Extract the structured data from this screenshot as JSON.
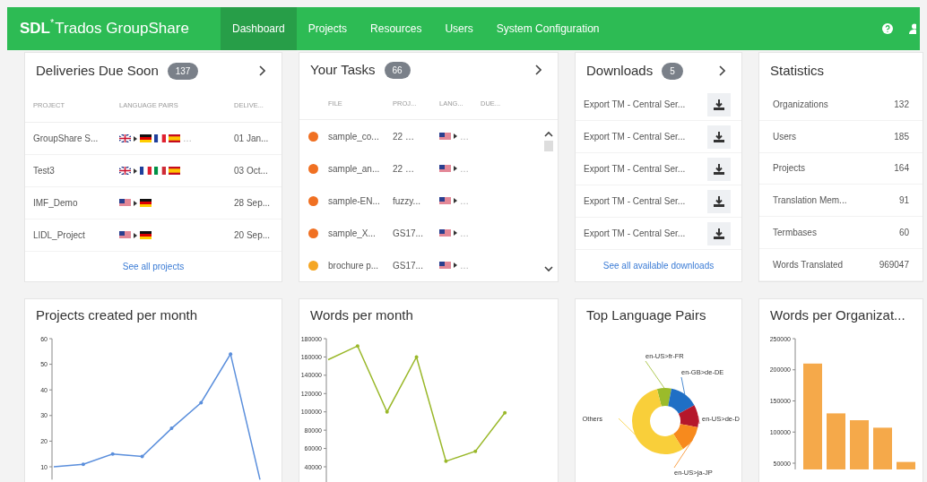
{
  "header": {
    "logo": {
      "brand": "SDL",
      "mark": "*",
      "product": "Trados GroupShare"
    },
    "nav": [
      {
        "label": "Dashboard",
        "selected": true
      },
      {
        "label": "Projects",
        "selected": false
      },
      {
        "label": "Resources",
        "selected": false
      },
      {
        "label": "Users",
        "selected": false
      },
      {
        "label": "System Configuration",
        "selected": false
      }
    ]
  },
  "deliveries": {
    "title": "Deliveries Due Soon",
    "count": "137",
    "columns": [
      "PROJECT",
      "LANGUAGE PAIRS",
      "DELIVE..."
    ],
    "rows": [
      {
        "project": "GroupShare S...",
        "source": {
          "kind": "uk"
        },
        "targets": [
          {
            "kind": "de"
          },
          {
            "kind": "fr"
          },
          {
            "kind": "es"
          }
        ],
        "more": "…",
        "date": "01 Jan..."
      },
      {
        "project": "Test3",
        "source": {
          "kind": "uk"
        },
        "targets": [
          {
            "kind": "fr"
          },
          {
            "kind": "it"
          },
          {
            "kind": "es"
          }
        ],
        "date": "03 Oct..."
      },
      {
        "project": "IMF_Demo",
        "source": {
          "kind": "us"
        },
        "targets": [
          {
            "kind": "de"
          }
        ],
        "date": "28 Sep..."
      },
      {
        "project": "LIDL_Project",
        "source": {
          "kind": "us"
        },
        "targets": [
          {
            "kind": "de"
          }
        ],
        "date": "20 Sep..."
      }
    ],
    "link": "See all projects"
  },
  "tasks": {
    "title": "Your Tasks",
    "count": "66",
    "columns": [
      "FILE",
      "PROJ...",
      "LANG...",
      "DUE..."
    ],
    "rows": [
      {
        "color": "#f07022",
        "file": "sample_co...",
        "project": "22 …",
        "source": {
          "kind": "us"
        },
        "more": "…"
      },
      {
        "color": "#f07022",
        "file": "sample_an...",
        "project": "22 …",
        "source": {
          "kind": "us"
        },
        "more": "…"
      },
      {
        "color": "#f07022",
        "file": "sample-EN...",
        "project": "fuzzy...",
        "source": {
          "kind": "us"
        },
        "more": "…"
      },
      {
        "color": "#f07022",
        "file": "sample_X...",
        "project": "GS17...",
        "source": {
          "kind": "us"
        },
        "more": "…"
      },
      {
        "color": "#f5a623",
        "file": "brochure p...",
        "project": "GS17...",
        "source": {
          "kind": "us"
        },
        "more": "…"
      }
    ]
  },
  "downloads": {
    "title": "Downloads",
    "count": "5",
    "items": [
      "Export TM - Central Ser...",
      "Export TM - Central Ser...",
      "Export TM - Central Ser...",
      "Export TM - Central Ser...",
      "Export TM - Central Ser..."
    ],
    "link": "See all available downloads"
  },
  "statistics": {
    "title": "Statistics",
    "rows": [
      {
        "label": "Organizations",
        "value": "132"
      },
      {
        "label": "Users",
        "value": "185"
      },
      {
        "label": "Projects",
        "value": "164"
      },
      {
        "label": "Translation Mem...",
        "value": "91"
      },
      {
        "label": "Termbases",
        "value": "60"
      },
      {
        "label": "Words Translated",
        "value": "969047"
      }
    ]
  },
  "charts": [
    {
      "title": "Projects created per month",
      "chart_data": {
        "type": "line",
        "series": [
          {
            "color": "#5b8fdc",
            "values": [
              10,
              11,
              15,
              14,
              25,
              35,
              54,
              5
            ]
          }
        ],
        "yticks": [
          10,
          20,
          30,
          40,
          50,
          60
        ],
        "ylim": [
          5,
          60
        ]
      }
    },
    {
      "title": "Words per month",
      "chart_data": {
        "type": "line",
        "series": [
          {
            "color": "#9ab82a",
            "values": [
              157000,
              172000,
              100000,
              160000,
              46000,
              57000,
              99000,
              null
            ]
          }
        ],
        "yticks": [
          40000,
          60000,
          80000,
          100000,
          120000,
          140000,
          160000,
          180000
        ],
        "ylim": [
          20000,
          180000
        ]
      }
    },
    {
      "title": "Top Language Pairs",
      "chart_data": {
        "type": "donut",
        "categories": [
          "en-US>fr-FR",
          "en-GB>de-DE",
          "en-US>de-D",
          "en-US>ja-JP",
          "Others"
        ],
        "series": [
          {
            "values": [
              7,
              14,
              11,
              13,
              55
            ]
          }
        ],
        "colors": [
          "#9bbb2a",
          "#1f6fc5",
          "#b5172b",
          "#f78a1d",
          "#f9cf3a"
        ]
      }
    },
    {
      "title": "Words per Organizat...",
      "chart_data": {
        "type": "bar",
        "series": [
          {
            "color": "#f5a94a",
            "values": [
              210000,
              130000,
              119000,
              107000,
              52000
            ]
          }
        ],
        "yticks": [
          50000,
          100000,
          150000,
          200000,
          250000
        ],
        "ylim": [
          40000,
          250000
        ]
      }
    }
  ]
}
